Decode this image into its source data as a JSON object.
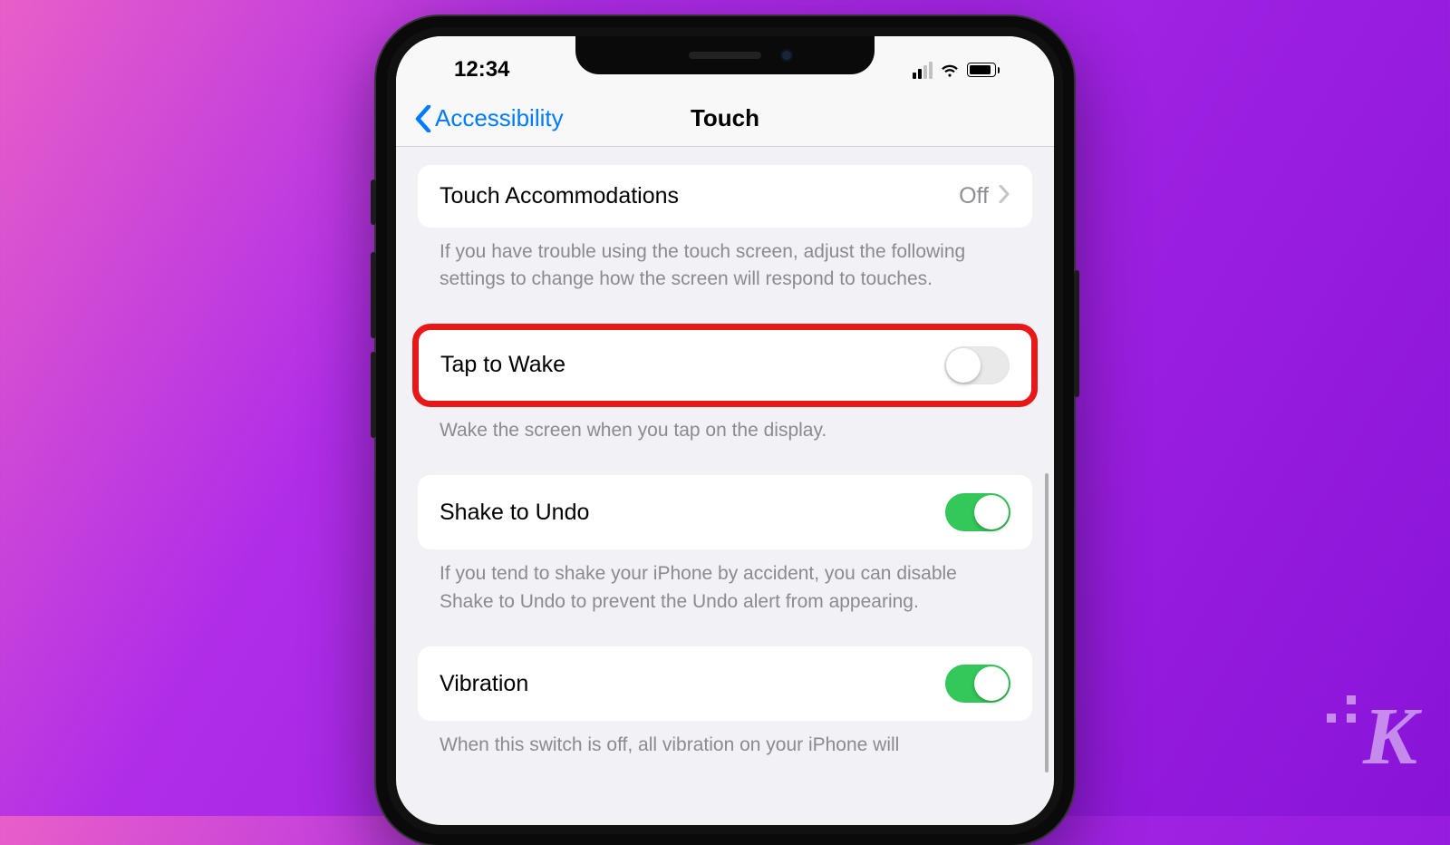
{
  "statusBar": {
    "time": "12:34"
  },
  "nav": {
    "back": "Accessibility",
    "title": "Touch"
  },
  "rows": {
    "touchAccommodations": {
      "label": "Touch Accommodations",
      "value": "Off"
    },
    "tapToWake": {
      "label": "Tap to Wake"
    },
    "shakeToUndo": {
      "label": "Shake to Undo"
    },
    "vibration": {
      "label": "Vibration"
    }
  },
  "footers": {
    "touchAccommodations": "If you have trouble using the touch screen, adjust the following settings to change how the screen will respond to touches.",
    "tapToWake": "Wake the screen when you tap on the display.",
    "shakeToUndo": "If you tend to shake your iPhone by accident, you can disable Shake to Undo to prevent the Undo alert from appearing.",
    "vibration": "When this switch is off, all vibration on your iPhone will"
  },
  "toggles": {
    "tapToWake": false,
    "shakeToUndo": true,
    "vibration": true
  },
  "watermark": "K"
}
